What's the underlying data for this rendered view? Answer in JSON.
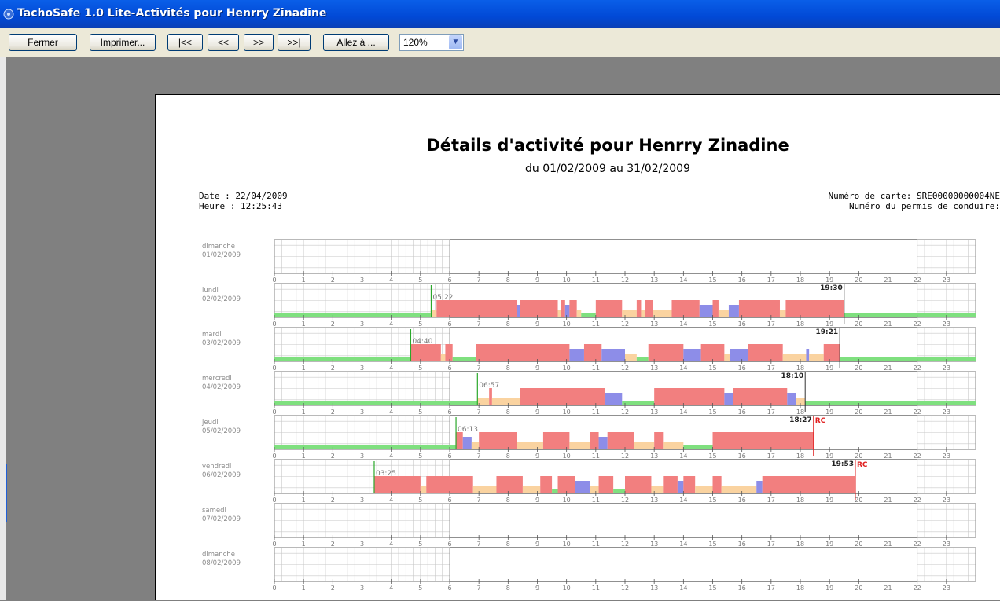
{
  "window": {
    "title": "TachoSafe 1.0 Lite-Activités pour Henrry Zinadine"
  },
  "toolbar": {
    "close_label": "Fermer",
    "print_label": "Imprimer...",
    "first_label": "|<<",
    "prev_label": "<<",
    "next_label": ">>",
    "last_label": ">>|",
    "goto_label": "Allez à ...",
    "zoom_value": "120%"
  },
  "report": {
    "title": "Détails d'activité pour Henrry Zinadine",
    "period": "du 01/02/2009 au 31/02/2009",
    "date_line": "Date : 22/04/2009",
    "time_line": "Heure : 12:25:43",
    "card_line": "Numéro de carte: SRE00000000004NE",
    "license_line": "Numéro du permis de conduire:"
  },
  "colors": {
    "rest": "#7fe07f",
    "drive": "#f27f7f",
    "work": "#fad3a0",
    "available": "#8d8de8",
    "start_marker": "#2ba82b",
    "rc_marker": "#e02020"
  },
  "chart_data": {
    "type": "timeline",
    "x_range": [
      0,
      24
    ],
    "hour_ticks": [
      "0",
      "1",
      "2",
      "3",
      "4",
      "5",
      "6",
      "7",
      "8",
      "9",
      "10",
      "11",
      "12",
      "13",
      "14",
      "15",
      "16",
      "17",
      "18",
      "19",
      "20",
      "21",
      "22",
      "23"
    ],
    "legend": [
      "rest",
      "drive",
      "work",
      "available"
    ],
    "days": [
      {
        "weekday": "dimanche",
        "date": "01/02/2009",
        "start": null,
        "end": null,
        "rc": false,
        "segments": []
      },
      {
        "weekday": "lundi",
        "date": "02/02/2009",
        "start": "05:22",
        "end": "19:30",
        "rc": false,
        "segments": [
          {
            "a": 0,
            "b": 5.35,
            "t": "rest"
          },
          {
            "a": 5.35,
            "b": 5.55,
            "t": "work"
          },
          {
            "a": 5.55,
            "b": 8.3,
            "t": "drive"
          },
          {
            "a": 8.3,
            "b": 8.4,
            "t": "available"
          },
          {
            "a": 8.4,
            "b": 9.7,
            "t": "drive"
          },
          {
            "a": 9.7,
            "b": 9.8,
            "t": "work"
          },
          {
            "a": 9.8,
            "b": 9.95,
            "t": "drive"
          },
          {
            "a": 9.95,
            "b": 10.1,
            "t": "available"
          },
          {
            "a": 10.1,
            "b": 10.35,
            "t": "drive"
          },
          {
            "a": 10.35,
            "b": 10.5,
            "t": "work"
          },
          {
            "a": 10.5,
            "b": 11.0,
            "t": "rest"
          },
          {
            "a": 11.0,
            "b": 11.9,
            "t": "drive"
          },
          {
            "a": 11.9,
            "b": 12.4,
            "t": "work"
          },
          {
            "a": 12.4,
            "b": 12.55,
            "t": "drive"
          },
          {
            "a": 12.55,
            "b": 12.7,
            "t": "work"
          },
          {
            "a": 12.7,
            "b": 12.95,
            "t": "drive"
          },
          {
            "a": 12.95,
            "b": 13.6,
            "t": "work"
          },
          {
            "a": 13.6,
            "b": 14.55,
            "t": "drive"
          },
          {
            "a": 14.55,
            "b": 15.0,
            "t": "available"
          },
          {
            "a": 15.0,
            "b": 15.2,
            "t": "drive"
          },
          {
            "a": 15.2,
            "b": 15.55,
            "t": "work"
          },
          {
            "a": 15.55,
            "b": 15.9,
            "t": "available"
          },
          {
            "a": 15.9,
            "b": 17.3,
            "t": "drive"
          },
          {
            "a": 17.3,
            "b": 17.5,
            "t": "work"
          },
          {
            "a": 17.5,
            "b": 19.5,
            "t": "drive"
          },
          {
            "a": 19.5,
            "b": 24,
            "t": "rest"
          }
        ]
      },
      {
        "weekday": "mardi",
        "date": "03/02/2009",
        "start": "04:40",
        "end": "19:21",
        "rc": false,
        "segments": [
          {
            "a": 0,
            "b": 4.67,
            "t": "rest"
          },
          {
            "a": 4.67,
            "b": 5.7,
            "t": "drive"
          },
          {
            "a": 5.7,
            "b": 5.85,
            "t": "work"
          },
          {
            "a": 5.85,
            "b": 6.1,
            "t": "drive"
          },
          {
            "a": 6.1,
            "b": 6.9,
            "t": "rest"
          },
          {
            "a": 6.9,
            "b": 10.1,
            "t": "drive"
          },
          {
            "a": 10.1,
            "b": 10.6,
            "t": "available"
          },
          {
            "a": 10.6,
            "b": 11.2,
            "t": "drive"
          },
          {
            "a": 11.2,
            "b": 12.0,
            "t": "available"
          },
          {
            "a": 12.0,
            "b": 12.4,
            "t": "work"
          },
          {
            "a": 12.4,
            "b": 12.8,
            "t": "rest"
          },
          {
            "a": 12.8,
            "b": 14.0,
            "t": "drive"
          },
          {
            "a": 14.0,
            "b": 14.6,
            "t": "available"
          },
          {
            "a": 14.6,
            "b": 15.4,
            "t": "drive"
          },
          {
            "a": 15.4,
            "b": 15.6,
            "t": "work"
          },
          {
            "a": 15.6,
            "b": 16.2,
            "t": "available"
          },
          {
            "a": 16.2,
            "b": 17.4,
            "t": "drive"
          },
          {
            "a": 17.4,
            "b": 18.2,
            "t": "work"
          },
          {
            "a": 18.2,
            "b": 18.3,
            "t": "available"
          },
          {
            "a": 18.3,
            "b": 18.8,
            "t": "work"
          },
          {
            "a": 18.8,
            "b": 19.35,
            "t": "drive"
          },
          {
            "a": 19.35,
            "b": 24,
            "t": "rest"
          }
        ]
      },
      {
        "weekday": "mercredi",
        "date": "04/02/2009",
        "start": "06:57",
        "end": "18:10",
        "rc": false,
        "segments": [
          {
            "a": 0,
            "b": 6.95,
            "t": "rest"
          },
          {
            "a": 6.95,
            "b": 7.35,
            "t": "work"
          },
          {
            "a": 7.35,
            "b": 7.45,
            "t": "drive"
          },
          {
            "a": 7.45,
            "b": 8.4,
            "t": "work"
          },
          {
            "a": 8.4,
            "b": 11.3,
            "t": "drive"
          },
          {
            "a": 11.3,
            "b": 11.9,
            "t": "available"
          },
          {
            "a": 11.9,
            "b": 13.0,
            "t": "rest"
          },
          {
            "a": 13.0,
            "b": 15.4,
            "t": "drive"
          },
          {
            "a": 15.4,
            "b": 15.7,
            "t": "available"
          },
          {
            "a": 15.7,
            "b": 17.55,
            "t": "drive"
          },
          {
            "a": 17.55,
            "b": 17.85,
            "t": "available"
          },
          {
            "a": 17.85,
            "b": 18.17,
            "t": "work"
          },
          {
            "a": 18.17,
            "b": 24,
            "t": "rest"
          }
        ]
      },
      {
        "weekday": "jeudi",
        "date": "05/02/2009",
        "start": "06:13",
        "end": "18:27",
        "rc": true,
        "segments": [
          {
            "a": 0,
            "b": 6.2,
            "t": "rest"
          },
          {
            "a": 6.2,
            "b": 6.45,
            "t": "drive"
          },
          {
            "a": 6.45,
            "b": 6.75,
            "t": "available"
          },
          {
            "a": 6.75,
            "b": 7.0,
            "t": "work"
          },
          {
            "a": 7.0,
            "b": 8.3,
            "t": "drive"
          },
          {
            "a": 8.3,
            "b": 9.2,
            "t": "work"
          },
          {
            "a": 9.2,
            "b": 10.1,
            "t": "drive"
          },
          {
            "a": 10.1,
            "b": 10.8,
            "t": "work"
          },
          {
            "a": 10.8,
            "b": 11.1,
            "t": "drive"
          },
          {
            "a": 11.1,
            "b": 11.4,
            "t": "available"
          },
          {
            "a": 11.4,
            "b": 12.3,
            "t": "drive"
          },
          {
            "a": 12.3,
            "b": 13.0,
            "t": "work"
          },
          {
            "a": 13.0,
            "b": 13.3,
            "t": "drive"
          },
          {
            "a": 13.3,
            "b": 14.0,
            "t": "work"
          },
          {
            "a": 14.0,
            "b": 15.0,
            "t": "rest"
          },
          {
            "a": 15.0,
            "b": 18.45,
            "t": "drive"
          }
        ]
      },
      {
        "weekday": "vendredi",
        "date": "06/02/2009",
        "start": "03:25",
        "end": "19:53",
        "rc": true,
        "segments": [
          {
            "a": 3.42,
            "b": 5.0,
            "t": "drive"
          },
          {
            "a": 5.0,
            "b": 5.2,
            "t": "work"
          },
          {
            "a": 5.2,
            "b": 6.8,
            "t": "drive"
          },
          {
            "a": 6.8,
            "b": 7.6,
            "t": "work"
          },
          {
            "a": 7.6,
            "b": 8.5,
            "t": "drive"
          },
          {
            "a": 8.5,
            "b": 9.1,
            "t": "work"
          },
          {
            "a": 9.1,
            "b": 9.5,
            "t": "drive"
          },
          {
            "a": 9.5,
            "b": 9.7,
            "t": "rest"
          },
          {
            "a": 9.7,
            "b": 10.3,
            "t": "drive"
          },
          {
            "a": 10.3,
            "b": 10.8,
            "t": "available"
          },
          {
            "a": 10.8,
            "b": 11.1,
            "t": "work"
          },
          {
            "a": 11.1,
            "b": 11.6,
            "t": "drive"
          },
          {
            "a": 11.6,
            "b": 12.0,
            "t": "rest"
          },
          {
            "a": 12.0,
            "b": 12.9,
            "t": "drive"
          },
          {
            "a": 12.9,
            "b": 13.3,
            "t": "work"
          },
          {
            "a": 13.3,
            "b": 13.8,
            "t": "drive"
          },
          {
            "a": 13.8,
            "b": 14.0,
            "t": "available"
          },
          {
            "a": 14.0,
            "b": 14.4,
            "t": "drive"
          },
          {
            "a": 14.4,
            "b": 15.0,
            "t": "work"
          },
          {
            "a": 15.0,
            "b": 15.3,
            "t": "drive"
          },
          {
            "a": 15.3,
            "b": 16.5,
            "t": "work"
          },
          {
            "a": 16.5,
            "b": 16.7,
            "t": "available"
          },
          {
            "a": 16.7,
            "b": 19.88,
            "t": "drive"
          }
        ]
      },
      {
        "weekday": "samedi",
        "date": "07/02/2009",
        "start": null,
        "end": null,
        "rc": false,
        "segments": []
      },
      {
        "weekday": "dimanche",
        "date": "08/02/2009",
        "start": null,
        "end": null,
        "rc": false,
        "segments": []
      }
    ]
  },
  "labels": {
    "rc": "RC"
  }
}
